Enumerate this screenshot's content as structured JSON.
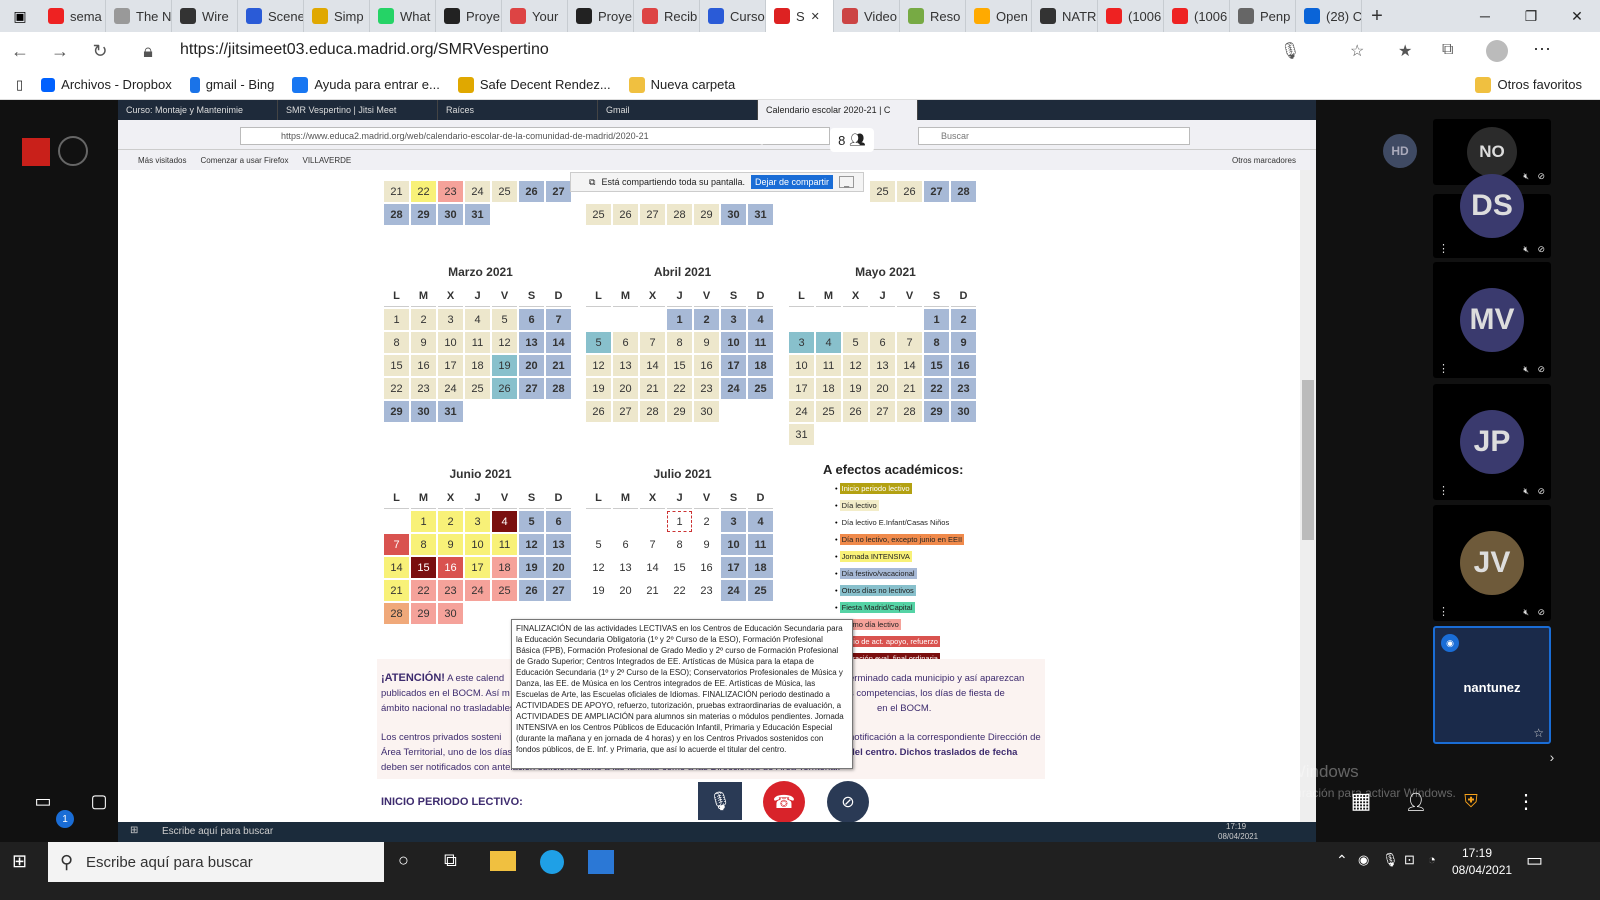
{
  "browser": {
    "tabs": [
      {
        "label": "sema",
        "color": "#e22"
      },
      {
        "label": "The N",
        "color": "#999"
      },
      {
        "label": "Wire",
        "color": "#333"
      },
      {
        "label": "Scene",
        "color": "#2a5bd7"
      },
      {
        "label": "Simp",
        "color": "#e0a800"
      },
      {
        "label": "What",
        "color": "#25d366"
      },
      {
        "label": "Proye",
        "color": "#222"
      },
      {
        "label": "Your",
        "color": "#d44"
      },
      {
        "label": "Proye",
        "color": "#222"
      },
      {
        "label": "Recib",
        "color": "#d44"
      },
      {
        "label": "Curso",
        "color": "#2a5bd7"
      },
      {
        "label": "S",
        "color": "#d22",
        "active": true
      },
      {
        "label": "Video",
        "color": "#c44"
      },
      {
        "label": "Reso",
        "color": "#7a4"
      },
      {
        "label": "Open",
        "color": "#fa0"
      },
      {
        "label": "NATR",
        "color": "#333"
      },
      {
        "label": "(1006",
        "color": "#e22"
      },
      {
        "label": "(1006",
        "color": "#e22"
      },
      {
        "label": "Penp",
        "color": "#666"
      },
      {
        "label": "(28) C",
        "color": "#0a64d8"
      }
    ],
    "url": "https://jitsimeet03.educa.madrid.org/SMRVespertino",
    "bookmarks": [
      "Archivos - Dropbox",
      "gmail - Bing",
      "Ayuda para entrar e...",
      "Safe Decent Rendez...",
      "Nueva carpeta"
    ],
    "other_favorites": "Otros favoritos"
  },
  "meeting": {
    "title": "SMR Vespertino",
    "participant_count": "8",
    "self_initials": "HD",
    "sharing_notice": "Está compartiendo toda su pantalla.",
    "stop_sharing": "Dejar de compartir",
    "chat_badge": "1",
    "participants": [
      {
        "initials": "NO",
        "color": "#2b2b2b"
      },
      {
        "initials": "DS",
        "color": "#3a3a6e"
      },
      {
        "initials": "MV",
        "color": "#3a3a6e"
      },
      {
        "initials": "JP",
        "color": "#3a3a6e"
      },
      {
        "initials": "JV",
        "color": "#6e5a3a"
      }
    ],
    "local_name": "nantunez"
  },
  "firefox": {
    "tabs": [
      "Curso: Montaje y Mantenimie",
      "SMR Vespertino | Jitsi Meet",
      "Raíces",
      "Gmail",
      "Calendario escolar 2020-21 | C"
    ],
    "url": "https://www.educa2.madrid.org/web/calendario-escolar-de-la-comunidad-de-madrid/2020-21",
    "search_placeholder": "Buscar",
    "bookmarks": [
      "Más visitados",
      "Comenzar a usar Firefox",
      "VILLAVERDE"
    ],
    "other_bookmarks": "Otros marcadores"
  },
  "calendar": {
    "dow": [
      "L",
      "M",
      "X",
      "J",
      "V",
      "S",
      "D"
    ],
    "months": [
      {
        "name": "Marzo 2021",
        "offset": 0,
        "days": 31,
        "styles": {
          "1": "beige",
          "2": "beige",
          "3": "beige",
          "4": "beige",
          "5": "beige",
          "6": "blue",
          "7": "blue",
          "8": "beige",
          "9": "beige",
          "10": "beige",
          "11": "beige",
          "12": "beige",
          "13": "blue",
          "14": "blue",
          "15": "beige",
          "16": "beige",
          "17": "beige",
          "18": "beige",
          "19": "teal",
          "20": "blue",
          "21": "blue",
          "22": "beige",
          "23": "beige",
          "24": "beige",
          "25": "beige",
          "26": "teal",
          "27": "blue",
          "28": "blue",
          "29": "blue",
          "30": "blue",
          "31": "blue"
        }
      },
      {
        "name": "Abril 2021",
        "offset": 3,
        "days": 30,
        "styles": {
          "1": "blue",
          "2": "blue",
          "3": "blue",
          "4": "blue",
          "5": "teal",
          "6": "beige",
          "7": "beige",
          "8": "beige",
          "9": "beige",
          "10": "blue",
          "11": "blue",
          "12": "beige",
          "13": "beige",
          "14": "beige",
          "15": "beige",
          "16": "beige",
          "17": "blue",
          "18": "blue",
          "19": "beige",
          "20": "beige",
          "21": "beige",
          "22": "beige",
          "23": "beige",
          "24": "blue",
          "25": "blue",
          "26": "beige",
          "27": "beige",
          "28": "beige",
          "29": "beige",
          "30": "beige"
        }
      },
      {
        "name": "Mayo 2021",
        "offset": 5,
        "days": 31,
        "styles": {
          "1": "blue",
          "2": "blue",
          "3": "teal",
          "4": "teal",
          "5": "beige",
          "6": "beige",
          "7": "beige",
          "8": "blue",
          "9": "blue",
          "10": "beige",
          "11": "beige",
          "12": "beige",
          "13": "beige",
          "14": "beige",
          "15": "blue",
          "16": "blue",
          "17": "beige",
          "18": "beige",
          "19": "beige",
          "20": "beige",
          "21": "beige",
          "22": "blue",
          "23": "blue",
          "24": "beige",
          "25": "beige",
          "26": "beige",
          "27": "beige",
          "28": "beige",
          "29": "blue",
          "30": "blue",
          "31": "beige"
        }
      },
      {
        "name": "Junio 2021",
        "offset": 1,
        "days": 30,
        "styles": {
          "1": "yellow",
          "2": "yellow",
          "3": "yellow",
          "4": "dred",
          "5": "blue",
          "6": "blue",
          "7": "red",
          "8": "yellow",
          "9": "yellow",
          "10": "yellow",
          "11": "yellow",
          "12": "blue",
          "13": "blue",
          "14": "yellow",
          "15": "dred",
          "16": "red",
          "17": "yellow",
          "18": "pink",
          "19": "blue",
          "20": "blue",
          "21": "yellow",
          "22": "pink",
          "23": "pink",
          "24": "pink",
          "25": "pink",
          "26": "blue",
          "27": "blue",
          "28": "orange",
          "29": "pink",
          "30": "pink"
        }
      },
      {
        "name": "Julio 2021",
        "offset": 3,
        "days": 25,
        "styles": {
          "1": "dotted",
          "3": "blue",
          "4": "blue",
          "10": "blue",
          "11": "blue",
          "17": "blue",
          "18": "blue",
          "24": "blue",
          "25": "blue"
        }
      }
    ],
    "top_rows": {
      "left": [
        "21",
        "22",
        "23",
        "24",
        "25",
        "26",
        "27",
        "28",
        "29",
        "30",
        "31"
      ],
      "middle": [
        "25",
        "26",
        "27",
        "28",
        "29",
        "30",
        "31"
      ],
      "right": [
        "25",
        "26",
        "27",
        "28"
      ]
    }
  },
  "legend": {
    "title": "A efectos académicos:",
    "items": [
      {
        "label": "Inicio periodo lectivo",
        "color": "#b3a112"
      },
      {
        "label": "Día lectivo",
        "color": "#f3edc9"
      },
      {
        "label": "Día lectivo E.Infant/Casas Niños",
        "color": "#ffffff"
      },
      {
        "label": "Día no lectivo, excepto junio en EEII",
        "color": "#f08a4b"
      },
      {
        "label": "Jornada INTENSIVA",
        "color": "#f8f178"
      },
      {
        "label": "Día festivo/vacacional",
        "color": "#a7b9d6"
      },
      {
        "label": "Otros días no lectivos",
        "color": "#88c0cc"
      },
      {
        "label": "Fiesta Madrid/Capital",
        "color": "#55d3a5"
      },
      {
        "label": "Último día lectivo",
        "color": "#f5a29a"
      },
      {
        "label": "Inicio de act. apoyo, refuerzo",
        "color": "#d9534f"
      },
      {
        "label": "...lización eval. final ordinaria",
        "color": "#7a0f0f"
      }
    ]
  },
  "tooltip": "FINALIZACIÓN de las actividades LECTIVAS en los Centros de Educación Secundaria para la Educación Secundaria Obligatoria (1º y 2º Curso de la ESO), Formación Profesional Básica (FPB), Formación Profesional de Grado Medio y 2º curso de Formación Profesional de Grado Superior; Centros Integrados de EE. Artísticas de Música para la etapa de Educación Secundaria (1º y 2º Curso de la ESO); Conservatorios Profesionales de Música y Danza, las EE. de Música en los Centros integrados de EE. Artísticas de Música, las Escuelas de Arte, las Escuelas oficiales de Idiomas. FINALIZACIÓN periodo destinado a ACTIVIDADES DE APOYO, refuerzo, tutorización, pruebas extraordinarias de evaluación, a ACTIVIDADES DE AMPLIACIÓN para alumnos sin materias o módulos pendientes. Jornada INTENSIVA en los Centros Públicos de Educación Infantil, Primaria y Educación Especial (durante la mañana y en jornada de 4 horas) y en los Centros Privados sostenidos con fondos públicos, de E. Inf. y Primaria, que así lo acuerde el titular del centro.",
  "notice": {
    "heading": "¡ATENCIÓN!",
    "line1": "A este calend",
    "line1b": "erminado cada municipio y así aparezcan",
    "line2": "publicados en el BOCM. Así m",
    "line2b": "s competencias,  los días de fiesta de",
    "line3": "ámbito nacional no trasladables",
    "line3b": "en el BOCM.",
    "line4": "Los centros privados sosteni",
    "line4b": "notificación a la correspondiente Dirección de",
    "line5": "Área Territorial, uno de los días",
    "line5b": "del centro. Dichos traslados de fecha",
    "line6": "deben ser notificados con antelación suficiente tanto a las familias como a las Direcciones de Área Territorial.",
    "section": "INICIO PERIODO LECTIVO:"
  },
  "watermark": {
    "line1": "Activar Windows",
    "line2": "Ve a Configuración para activar Windows."
  },
  "inner_taskbar": {
    "search": "Escribe aquí para buscar",
    "time": "17:19",
    "date": "08/04/2021"
  },
  "taskbar": {
    "search": "Escribe aquí para buscar",
    "time": "17:19",
    "date": "08/04/2021"
  }
}
